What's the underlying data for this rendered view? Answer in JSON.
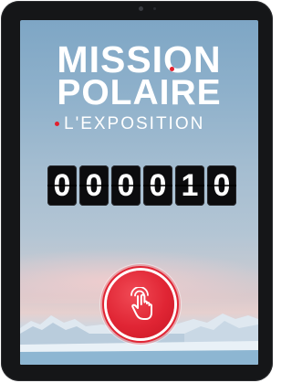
{
  "exhibit": {
    "title_line_1": "MISSION",
    "title_line_2": "POLAIRE",
    "subtitle": "L'EXPOSITION"
  },
  "counter": {
    "digits": [
      "0",
      "0",
      "0",
      "0",
      "1",
      "0"
    ]
  },
  "touch_button": {
    "icon": "hand-tap-icon"
  },
  "colors": {
    "accent_red": "#e3202f",
    "tablet_frame": "#151618",
    "counter_tile": "#0c0c0e"
  }
}
